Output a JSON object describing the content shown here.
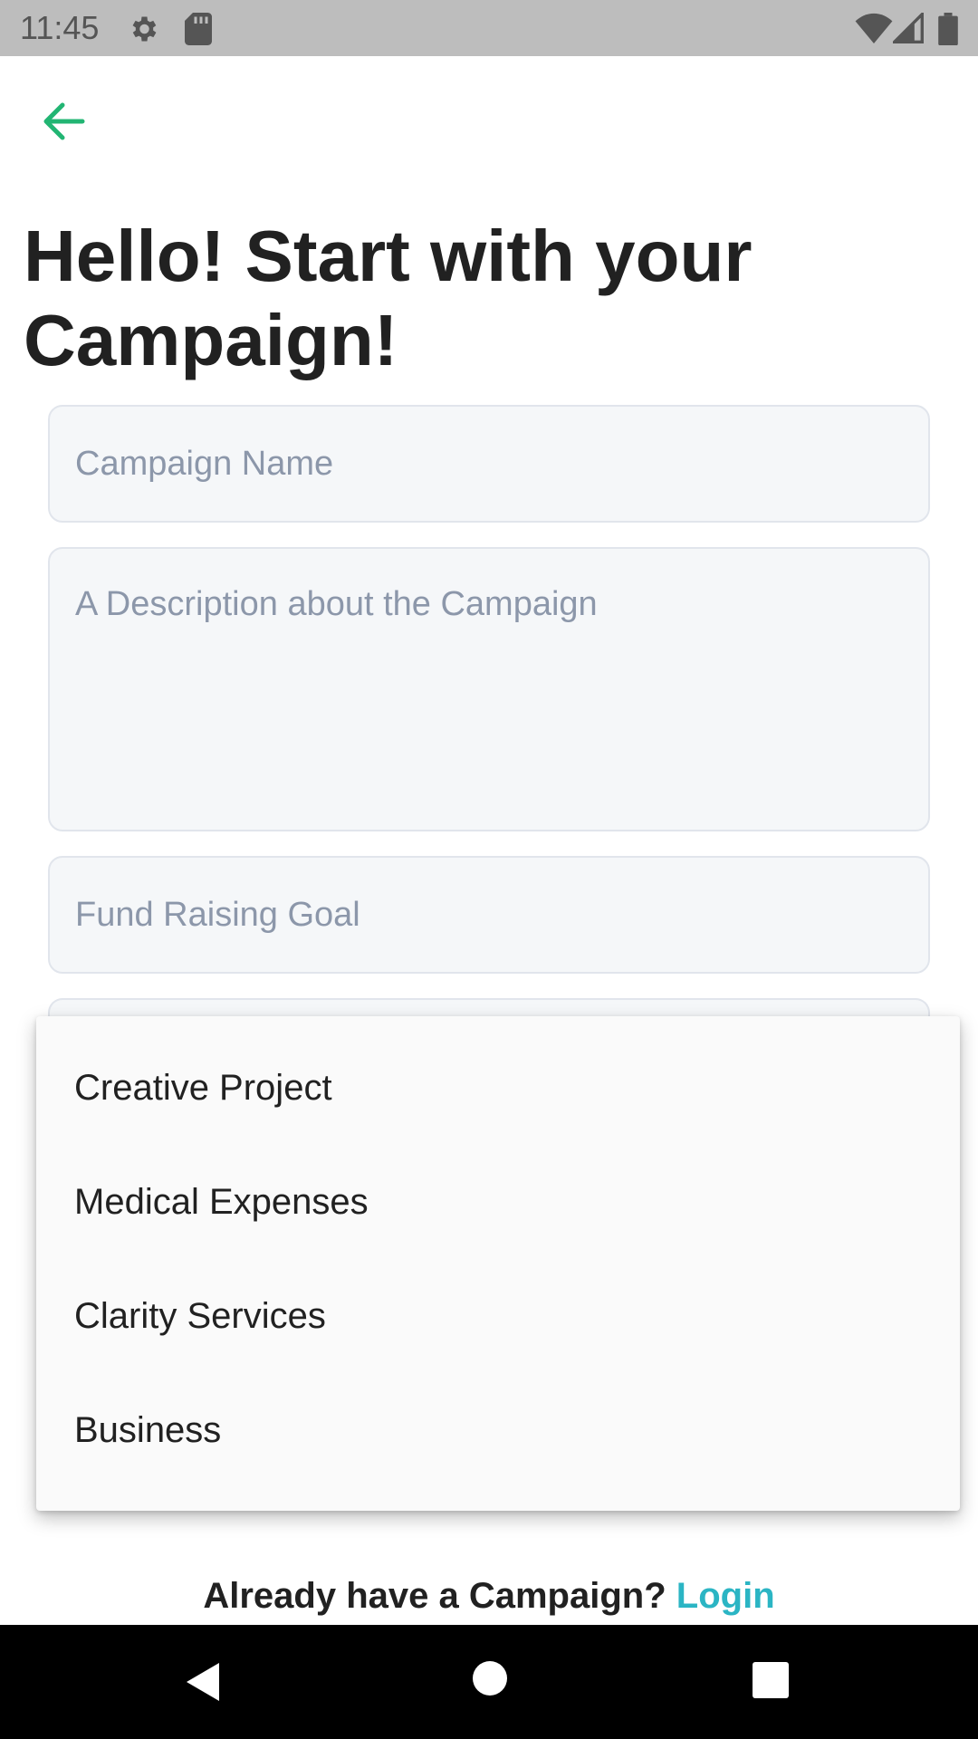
{
  "status_bar": {
    "time": "11:45",
    "icons": [
      "settings-icon",
      "sd-card-icon",
      "wifi-icon",
      "signal-icon",
      "battery-icon"
    ]
  },
  "header": {
    "back_icon": "arrow-left-icon",
    "title": "Hello! Start with your Campaign!"
  },
  "form": {
    "campaign_name": {
      "placeholder": "Campaign Name",
      "value": ""
    },
    "description": {
      "placeholder": "A Description about the Campaign",
      "value": ""
    },
    "fund_goal": {
      "placeholder": "Fund Raising Goal",
      "value": ""
    }
  },
  "category_dropdown": {
    "options": [
      "Creative Project",
      "Medical Expenses",
      "Clarity Services",
      "Business"
    ]
  },
  "footer": {
    "prompt": "Already have a Campaign?",
    "login_label": "Login"
  },
  "nav_bar": {
    "icons": [
      "nav-back-icon",
      "nav-home-icon",
      "nav-recents-icon"
    ]
  },
  "colors": {
    "accent_green": "#22b573",
    "link_teal": "#2bb5c4",
    "field_bg": "#f5f7f9",
    "status_bar_bg": "#bdbdbd"
  }
}
